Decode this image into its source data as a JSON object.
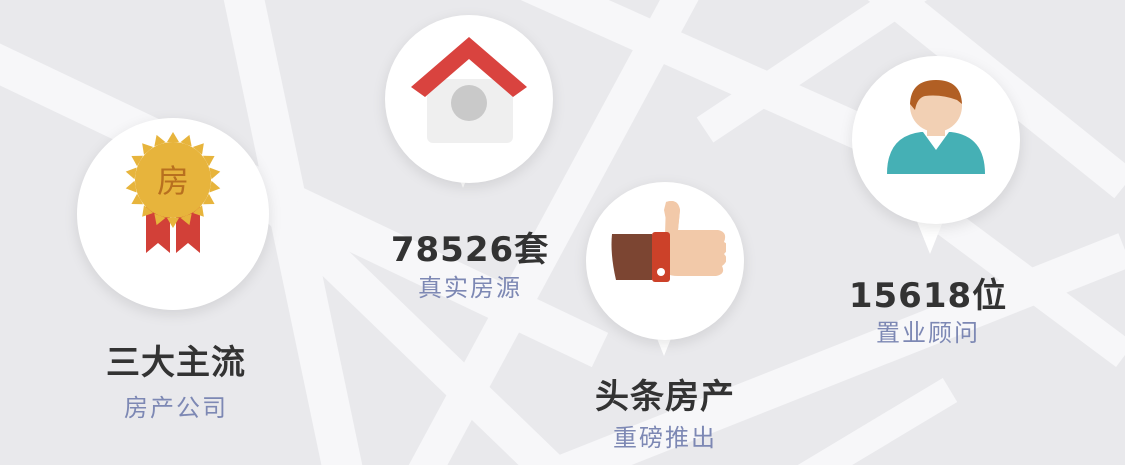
{
  "badge_char": "房",
  "stats": [
    {
      "main": "三大主流",
      "sub": "房产公司"
    },
    {
      "main": "78526套",
      "sub": "真实房源"
    },
    {
      "main": "头条房产",
      "sub": "重磅推出"
    },
    {
      "main": "15618位",
      "sub": "置业顾问"
    }
  ],
  "colors": {
    "background": "#e9e9ec",
    "road": "#f7f7f9",
    "pin": "#ffffff",
    "title": "#333333",
    "subtitle": "#7d88b4",
    "badge_gold": "#e7b43c",
    "badge_ribbon": "#d24038",
    "roof_red": "#d9433f",
    "house_body": "#efefef",
    "hand_skin": "#f2c9a9",
    "sleeve_brown": "#7c4532",
    "cuff_red": "#cc4129",
    "hair_brown": "#b15f24",
    "shirt_teal": "#45b0b5"
  },
  "icons": [
    "badge-icon",
    "house-icon",
    "thumbs-up-icon",
    "advisor-icon"
  ]
}
